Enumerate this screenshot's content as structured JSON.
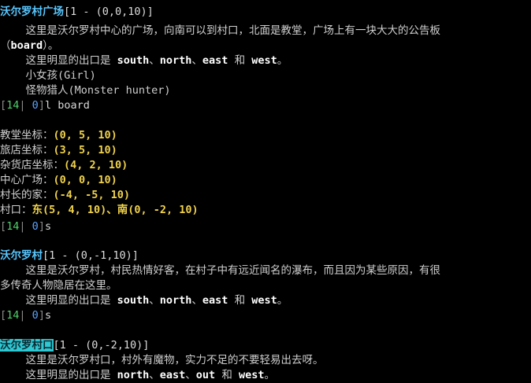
{
  "room1": {
    "name": "沃尔罗村广场",
    "coord": "[1 - (0,0,10)]",
    "desc1": "    这里是沃尔罗村中心的广场，向南可以到村口，北面是教堂，广场上有一块大大的公告板",
    "desc2_pre": "（",
    "desc2_item": "board",
    "desc2_post": "）。",
    "exits_pre": "    这里明显的出口是 ",
    "exits_a": "south",
    "sep1": "、",
    "exits_b": "north",
    "sep2": "、",
    "exits_c": "east",
    "and": " 和 ",
    "exits_d": "west",
    "end": "。",
    "npc1": "    小女孩(Girl)",
    "npc2": "    怪物猎人(Monster hunter)"
  },
  "prompt1": {
    "open": "[",
    "hp": "14",
    "bar": "|",
    "mp": " 0",
    "close": "]",
    "cmd": "l board"
  },
  "board": {
    "rows": [
      {
        "label": "教堂坐标：",
        "value": "(0, 5, 10)"
      },
      {
        "label": "旅店坐标：",
        "value": "(3, 5, 10)"
      },
      {
        "label": "杂货店坐标：",
        "value": "(4, 2, 10)"
      },
      {
        "label": "中心广场：",
        "value": "(0, 0, 10)"
      },
      {
        "label": "村长的家：",
        "value": "(-4, -5, 10)"
      }
    ],
    "gate_label": "村口：",
    "gate_value": "东(5, 4, 10)、南(0, -2, 10)"
  },
  "prompt2": {
    "open": "[",
    "hp": "14",
    "bar": "|",
    "mp": " 0",
    "close": "]",
    "cmd": "s"
  },
  "room2": {
    "name": "沃尔罗村",
    "coord": "[1 - (0,-1,10)]",
    "desc1": "    这里是沃尔罗村，村民热情好客，在村子中有远近闻名的瀑布，而且因为某些原因，有很",
    "desc2": "多传奇人物隐居在这里。",
    "exits_pre": "    这里明显的出口是 ",
    "exits_a": "south",
    "sep1": "、",
    "exits_b": "north",
    "sep2": "、",
    "exits_c": "east",
    "and": " 和 ",
    "exits_d": "west",
    "end": "。"
  },
  "prompt3": {
    "open": "[",
    "hp": "14",
    "bar": "|",
    "mp": " 0",
    "close": "]",
    "cmd": "s"
  },
  "room3": {
    "name": "沃尔罗村口",
    "coord": "[1 - (0,-2,10)]",
    "desc1": "    这里是沃尔罗村口，村外有魔物，实力不足的不要轻易出去呀。",
    "exits_pre": "    这里明显的出口是 ",
    "exits_a": "north",
    "sep1": "、",
    "exits_b": "east",
    "sep2": "、",
    "exits_c": "out",
    "and": " 和 ",
    "exits_d": "west",
    "end": "。"
  }
}
